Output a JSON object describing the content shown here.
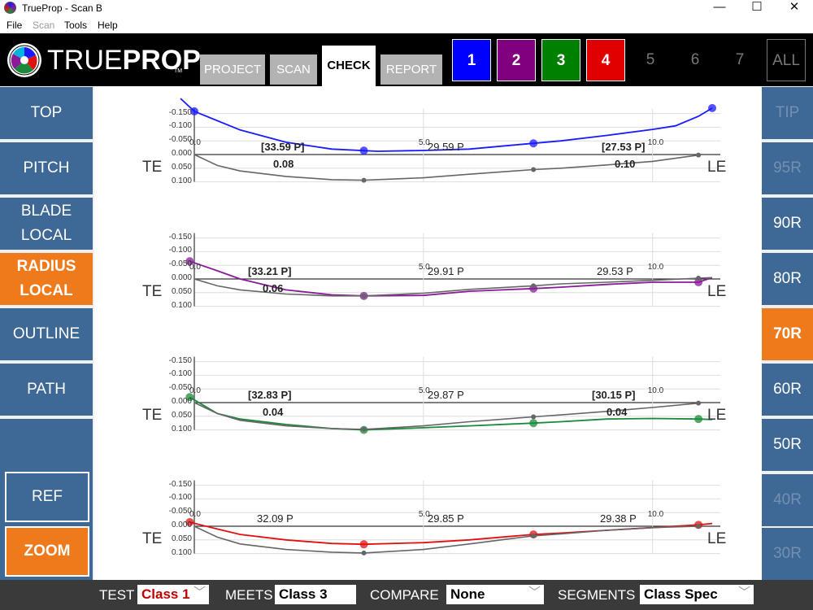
{
  "window": {
    "title": "TrueProp - Scan B",
    "minimize": "—",
    "maximize": "☐",
    "close": "✕"
  },
  "menu": [
    "File",
    "Scan",
    "Tools",
    "Help"
  ],
  "logo": {
    "word1": "TRUE",
    "word2": "PROP",
    "tm": "TM"
  },
  "tabs": [
    "PROJECT",
    "SCAN",
    "CHECK",
    "REPORT"
  ],
  "blades": [
    {
      "label": "1",
      "color": "#0000ff"
    },
    {
      "label": "2",
      "color": "#800080"
    },
    {
      "label": "3",
      "color": "#008000"
    },
    {
      "label": "4",
      "color": "#e00000"
    },
    {
      "label": "5"
    },
    {
      "label": "6"
    },
    {
      "label": "7"
    },
    {
      "label": "ALL"
    }
  ],
  "left_nav": {
    "top": "TOP",
    "pitch": "PITCH",
    "blade_local_1": "BLADE",
    "blade_local_2": "LOCAL",
    "radius_local_1": "RADIUS",
    "radius_local_2": "LOCAL",
    "outline": "OUTLINE",
    "path": "PATH",
    "ref": "REF",
    "zoom": "ZOOM"
  },
  "right_nav": [
    "TIP",
    "95R",
    "90R",
    "80R",
    "70R",
    "60R",
    "50R",
    "40R",
    "30R"
  ],
  "plot_common": {
    "y_ticks": [
      "-0.150",
      "-0.100",
      "-0.050",
      "0.000",
      "0.050",
      "0.100"
    ],
    "x_ticks": [
      "0.0",
      "5.0",
      "10.0"
    ],
    "te": "TE",
    "le": "LE"
  },
  "chart_data": [
    {
      "type": "line",
      "blade": "1",
      "labels": [
        "[33.59 P]",
        "29.59 P",
        "[27.53 P]"
      ],
      "deviations": [
        "0.08",
        "0.10"
      ],
      "series": [
        {
          "color": "#1a1aff",
          "points": [
            [
              -0.3,
              -0.205
            ],
            [
              0,
              -0.158
            ],
            [
              1,
              -0.09
            ],
            [
              2,
              -0.045
            ],
            [
              3,
              -0.02
            ],
            [
              4,
              -0.012
            ],
            [
              5,
              -0.015
            ],
            [
              6,
              -0.02
            ],
            [
              7,
              -0.035
            ],
            [
              8,
              -0.05
            ],
            [
              9,
              -0.07
            ],
            [
              10,
              -0.092
            ],
            [
              10.5,
              -0.105
            ],
            [
              11,
              -0.14
            ],
            [
              11.3,
              -0.17
            ]
          ],
          "markers": [
            0,
            3.7,
            7.4,
            11.3
          ]
        },
        {
          "color": "#666666",
          "points": [
            [
              0,
              0
            ],
            [
              0.5,
              0.04
            ],
            [
              1,
              0.06
            ],
            [
              2,
              0.08
            ],
            [
              3,
              0.092
            ],
            [
              3.7,
              0.094
            ],
            [
              5,
              0.085
            ],
            [
              6,
              0.072
            ],
            [
              7.4,
              0.055
            ],
            [
              8,
              0.05
            ],
            [
              9,
              0.038
            ],
            [
              10,
              0.025
            ],
            [
              11,
              0.002
            ]
          ],
          "markers": [
            3.7,
            7.4,
            11
          ]
        }
      ]
    },
    {
      "type": "line",
      "blade": "2",
      "labels": [
        "[33.21 P]",
        "29.91 P",
        "29.53 P"
      ],
      "deviations": [
        "0.06"
      ],
      "series": [
        {
          "color": "#8a1a9a",
          "points": [
            [
              -0.1,
              -0.065
            ],
            [
              0.5,
              -0.03
            ],
            [
              1,
              0
            ],
            [
              2,
              0.04
            ],
            [
              3,
              0.058
            ],
            [
              3.7,
              0.062
            ],
            [
              5,
              0.06
            ],
            [
              6,
              0.045
            ],
            [
              7.4,
              0.035
            ],
            [
              8,
              0.03
            ],
            [
              9,
              0.02
            ],
            [
              10,
              0.012
            ],
            [
              11,
              0.012
            ],
            [
              11.3,
              -0.005
            ]
          ],
          "markers": [
            -0.1,
            3.7,
            7.4,
            11
          ]
        },
        {
          "color": "#666666",
          "points": [
            [
              0,
              0
            ],
            [
              0.5,
              0.025
            ],
            [
              1,
              0.04
            ],
            [
              2,
              0.055
            ],
            [
              3,
              0.062
            ],
            [
              3.7,
              0.062
            ],
            [
              5,
              0.052
            ],
            [
              6,
              0.038
            ],
            [
              7.4,
              0.025
            ],
            [
              8,
              0.018
            ],
            [
              9,
              0.012
            ],
            [
              10,
              0.005
            ],
            [
              11,
              -0.003
            ],
            [
              11.3,
              -0.005
            ]
          ],
          "markers": [
            3.7,
            7.4,
            11
          ]
        }
      ]
    },
    {
      "type": "line",
      "blade": "3",
      "labels": [
        "[32.83 P]",
        "29.87 P",
        "[30.15 P]"
      ],
      "deviations": [
        "0.04",
        "0.04"
      ],
      "series": [
        {
          "color": "#1a8a3a",
          "points": [
            [
              -0.1,
              -0.02
            ],
            [
              0.5,
              0.04
            ],
            [
              1,
              0.06
            ],
            [
              2,
              0.08
            ],
            [
              3,
              0.095
            ],
            [
              3.7,
              0.1
            ],
            [
              5,
              0.092
            ],
            [
              6,
              0.085
            ],
            [
              7.4,
              0.075
            ],
            [
              8,
              0.07
            ],
            [
              9,
              0.06
            ],
            [
              10,
              0.058
            ],
            [
              11,
              0.06
            ],
            [
              11.3,
              0.062
            ]
          ],
          "markers": [
            -0.1,
            3.7,
            7.4,
            11
          ]
        },
        {
          "color": "#666666",
          "points": [
            [
              0,
              0
            ],
            [
              0.5,
              0.04
            ],
            [
              1,
              0.065
            ],
            [
              2,
              0.085
            ],
            [
              3,
              0.095
            ],
            [
              3.7,
              0.098
            ],
            [
              5,
              0.085
            ],
            [
              6,
              0.07
            ],
            [
              7.4,
              0.052
            ],
            [
              8,
              0.045
            ],
            [
              9,
              0.032
            ],
            [
              10,
              0.018
            ],
            [
              11,
              0.002
            ]
          ],
          "markers": [
            3.7,
            7.4,
            11
          ]
        }
      ]
    },
    {
      "type": "line",
      "blade": "4",
      "labels": [
        "32.09 P",
        "29.85 P",
        "29.38 P"
      ],
      "deviations": [],
      "series": [
        {
          "color": "#e01010",
          "points": [
            [
              -0.1,
              -0.015
            ],
            [
              0.5,
              0.01
            ],
            [
              1,
              0.03
            ],
            [
              2,
              0.05
            ],
            [
              3,
              0.063
            ],
            [
              3.7,
              0.066
            ],
            [
              5,
              0.06
            ],
            [
              6,
              0.05
            ],
            [
              7.4,
              0.03
            ],
            [
              8,
              0.025
            ],
            [
              9,
              0.015
            ],
            [
              10,
              0.005
            ],
            [
              11,
              -0.005
            ],
            [
              11.3,
              -0.01
            ]
          ],
          "markers": [
            -0.1,
            3.7,
            7.4,
            11
          ]
        },
        {
          "color": "#666666",
          "points": [
            [
              0,
              0
            ],
            [
              0.5,
              0.04
            ],
            [
              1,
              0.065
            ],
            [
              2,
              0.085
            ],
            [
              3,
              0.095
            ],
            [
              3.7,
              0.098
            ],
            [
              5,
              0.085
            ],
            [
              6,
              0.065
            ],
            [
              7.4,
              0.035
            ],
            [
              8,
              0.028
            ],
            [
              9,
              0.015
            ],
            [
              10,
              0.005
            ],
            [
              11,
              0
            ]
          ],
          "markers": [
            3.7,
            7.4,
            11
          ]
        }
      ]
    }
  ],
  "footer": {
    "test_label": "TEST",
    "test_value": "Class 1",
    "meets_label": "MEETS",
    "meets_value": "Class 3",
    "compare_label": "COMPARE",
    "compare_value": "None",
    "segments_label": "SEGMENTS",
    "segments_value": "Class Spec"
  }
}
